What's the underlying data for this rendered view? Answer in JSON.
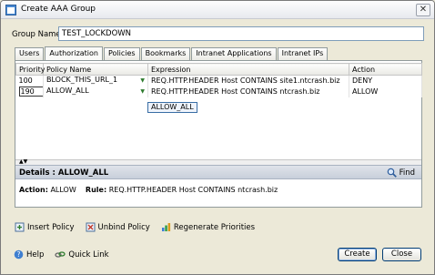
{
  "window": {
    "title": "Create AAA Group",
    "close_glyph": "✕"
  },
  "form": {
    "group_name_label": "Group Name*",
    "group_name_value": "TEST_LOCKDOWN"
  },
  "tabs": [
    {
      "label": "Users",
      "active": false
    },
    {
      "label": "Authorization",
      "active": true
    },
    {
      "label": "Policies",
      "active": false
    },
    {
      "label": "Bookmarks",
      "active": false
    },
    {
      "label": "Intranet Applications",
      "active": false
    },
    {
      "label": "Intranet IPs",
      "active": false
    }
  ],
  "table": {
    "columns": [
      "Priority",
      "Policy Name",
      "Expression",
      "Action"
    ],
    "rows": [
      {
        "priority": "100",
        "policy": "BLOCK_THIS_URL_1",
        "expression": "REQ.HTTP.HEADER Host CONTAINS site1.ntcrash.biz",
        "action": "DENY"
      },
      {
        "priority": "190",
        "policy": "ALLOW_ALL",
        "expression": "REQ.HTTP.HEADER Host CONTAINS ntcrash.biz",
        "action": "ALLOW"
      }
    ],
    "dropdown_popup_value": "ALLOW_ALL"
  },
  "details": {
    "header": "Details : ALLOW_ALL",
    "find_label": "Find",
    "action_label": "Action:",
    "action_value": "ALLOW",
    "rule_label": "Rule:",
    "rule_value": "REQ.HTTP.HEADER Host CONTAINS ntcrash.biz"
  },
  "policy_toolbar": {
    "insert_label": "Insert Policy",
    "unbind_label": "Unbind Policy",
    "regenerate_label": "Regenerate Priorities"
  },
  "footer": {
    "help_label": "Help",
    "quicklink_label": "Quick Link",
    "create_label": "Create",
    "close_label": "Close"
  },
  "colors": {
    "accent": "#3a6ea5",
    "header_bg": "#c8cfda",
    "window_bg": "#ece9d8"
  },
  "icons": [
    "app-window-icon",
    "close-icon",
    "dropdown-arrow-icon",
    "find-icon",
    "insert-policy-icon",
    "unbind-policy-icon",
    "regenerate-priorities-icon",
    "help-icon",
    "quick-link-icon"
  ]
}
